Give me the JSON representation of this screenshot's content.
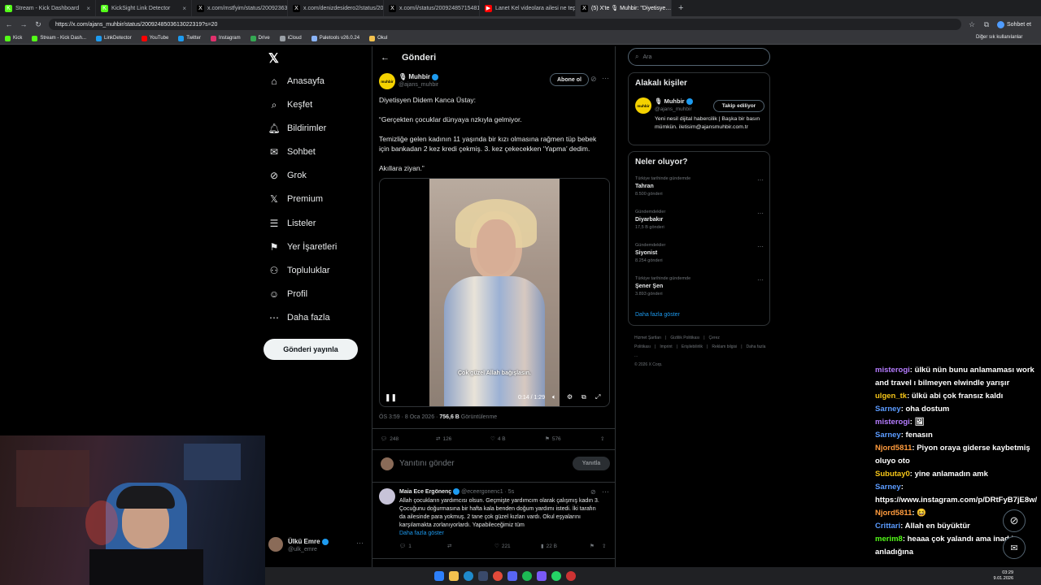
{
  "browser": {
    "tabs": [
      {
        "label": "Stream - Kick Dashboard",
        "icon": "kick-icon",
        "color": "#53fc18"
      },
      {
        "label": "KickSight Link Detector",
        "icon": "kick-icon",
        "color": "#53fc18"
      },
      {
        "label": "x.com/mstfyim/status/200923638…",
        "icon": "x-icon",
        "color": "#000000"
      },
      {
        "label": "x.com/denizdesidero2/status/200…",
        "icon": "x-icon",
        "color": "#000000"
      },
      {
        "label": "x.com/i/status/2009248571548117…",
        "icon": "x-icon",
        "color": "#000000"
      },
      {
        "label": "Lanet Kel videolara ailesi ne tepki…",
        "icon": "youtube-icon",
        "color": "#ff0000"
      },
      {
        "label": "(5) X'te 🎙 Muhbir: \"Diyetisye…",
        "icon": "x-icon",
        "color": "#000000",
        "active": true
      }
    ],
    "url": "https://x.com/ajans_muhbir/status/2009248503613022319?s=20",
    "bookmarks": [
      "Kick",
      "Stream - Kick Dash...",
      "LinkDetector",
      "YouTube",
      "Twitter",
      "Instagram",
      "Drive",
      "iCloud",
      "Paletools v26.0.24",
      "Okul"
    ],
    "other_bookmarks": "Diğer sık kullanılanlar",
    "chat_btn": "Sohbet et"
  },
  "sidebar": {
    "items": [
      {
        "label": "Anasayfa",
        "icon": "home-icon"
      },
      {
        "label": "Keşfet",
        "icon": "search-icon"
      },
      {
        "label": "Bildirimler",
        "icon": "bell-icon"
      },
      {
        "label": "Sohbet",
        "icon": "mail-icon"
      },
      {
        "label": "Grok",
        "icon": "grok-icon"
      },
      {
        "label": "Premium",
        "icon": "x-icon"
      },
      {
        "label": "Listeler",
        "icon": "list-icon"
      },
      {
        "label": "Yer İşaretleri",
        "icon": "bookmark-icon"
      },
      {
        "label": "Topluluklar",
        "icon": "people-icon"
      },
      {
        "label": "Profil",
        "icon": "person-icon"
      },
      {
        "label": "Daha fazla",
        "icon": "more-icon"
      }
    ],
    "post_button": "Gönderi yayınla",
    "account": {
      "name": "Ülkü Emre",
      "handle": "@ulk_emre"
    }
  },
  "post": {
    "header": "Gönderi",
    "author_name": "🎙 Muhbir",
    "author_handle": "@ajans_muhbir",
    "avatar_text": "muhbir",
    "subscribe": "Abone ol",
    "text": [
      "Diyetisyen Didem Kanca Üstay:",
      "“Gerçekten çocuklar dünyaya nzkıyla gelmiyor.",
      "Temizliğe gelen kadının 11 yaşında bir kızı olmasına rağmen tüp bebek için bankadan 2 kez kredi çekmiş. 3. kez çekecekken ‘Yapma’ dedim.",
      "Akıllara ziyan.”"
    ],
    "video": {
      "caption": "Çok güzel Allah bağışlasın.",
      "time": "0:14 / 1:29"
    },
    "meta_time": "ÖS 3:59 · 8 Oca 2026 · ",
    "views": "756,6 B",
    "views_label": " Görüntülenme",
    "actions": {
      "replies": "248",
      "reposts": "126",
      "likes": "4 B",
      "bookmarks": "576"
    },
    "reply_placeholder": "Yanıtını gönder",
    "reply_button": "Yanıtla"
  },
  "comment": {
    "name": "Maia Ece Ergönenç",
    "handle": "@eceergonenc1 · 5s",
    "text": "Allah çocukların yardımcısı olsun. Geçmişte yardımcım olarak çalışmış kadın 3. Çocuğunu doğurmasına bir hafta kala benden doğum yardımı istedi. İki tarafın da ailesinde para yokmuş. 2 tane çok güzel kızları vardı. Okul eşyalarını karşılamakta zorlanıyorlardı. Yapabileceğimiz tüm",
    "more": "Daha fazla göster",
    "actions": {
      "replies": "1",
      "likes": "221",
      "views": "22 B"
    }
  },
  "right": {
    "search_placeholder": "Ara",
    "related_title": "Alakalı kişiler",
    "related": {
      "name": "🎙 Muhbir",
      "handle": "@ajans_muhbir",
      "button": "Takip ediliyor",
      "bio": "Yeni nesil dijital habercilik | Başka bir basın mümkün. iletisim@ajansmuhbir.com.tr"
    },
    "trends_title": "Neler oluyor?",
    "trends": [
      {
        "context": "Türkiye tarihinde gündemde",
        "topic": "Tahran",
        "count": "8.500 gönderi"
      },
      {
        "context": "Gündemdekiler",
        "topic": "Diyarbakır",
        "count": "17,5 B gönderi"
      },
      {
        "context": "Gündemdekiler",
        "topic": "Siyonist",
        "count": "8.254 gönderi"
      },
      {
        "context": "Türkiye tarihinde gündemde",
        "topic": "Şener Şen",
        "count": "3.893 gönderi"
      }
    ],
    "show_more": "Daha fazla göster",
    "footer": [
      "Hizmet Şartları",
      "|",
      "Gizlilik Politikası",
      "|",
      "Çerez Politikası",
      "|",
      "Imprint",
      "|",
      "Erişilebilirlik",
      "|",
      "Reklam bilgisi",
      "|",
      "Daha fazla ...",
      "© 2026 X Corp."
    ]
  },
  "chat": [
    {
      "user": "misterogi",
      "color": "#b57cff",
      "text": ": ülkü nün bunu anlamaması work and travel ı bilmeyen elwindle yarışır"
    },
    {
      "user": "ulgen_tk",
      "color": "#f5c518",
      "text": ": ülkü abi çok fransız kaldı"
    },
    {
      "user": "Sarney",
      "color": "#5b9bff",
      "text": ": oha dostum"
    },
    {
      "user": "misterogi",
      "color": "#b57cff",
      "text": ": 🖼"
    },
    {
      "user": "Sarney",
      "color": "#5b9bff",
      "text": ": fenasın"
    },
    {
      "user": "Njord5811",
      "color": "#ff9b3d",
      "text": ": Piyon oraya giderse kaybetmiş oluyo oto"
    },
    {
      "user": "Subutay0",
      "color": "#f5c518",
      "text": ": yine anlamadın amk"
    },
    {
      "user": "Sarney",
      "color": "#5b9bff",
      "text": ": https://www.instagram.com/p/DRtFyB7jE8w/"
    },
    {
      "user": "Njord5811",
      "color": "#ff9b3d",
      "text": ": 😆"
    },
    {
      "user": "Crittari",
      "color": "#5b9bff",
      "text": ": Allah en büyüktür"
    },
    {
      "user": "merim8",
      "color": "#53fc18",
      "text": ": heaaa çok yalandı ama inadık anladığına"
    }
  ],
  "taskbar": {
    "time": "03:29",
    "date": "9.01.2026"
  }
}
